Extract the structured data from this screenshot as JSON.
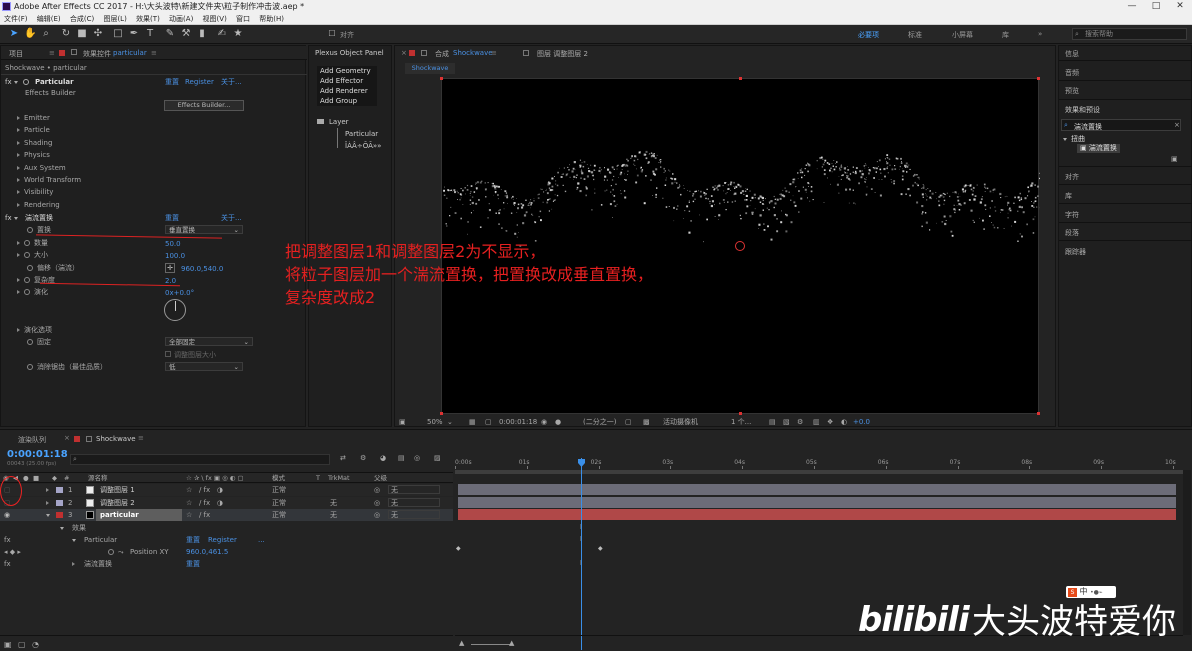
{
  "title": "Adobe After Effects CC 2017 - H:\\大头波特\\新建文件夹\\粒子制作冲击波.aep *",
  "menu": [
    "文件(F)",
    "编辑(E)",
    "合成(C)",
    "图层(L)",
    "效果(T)",
    "动画(A)",
    "视图(V)",
    "窗口",
    "帮助(H)"
  ],
  "toolbar": {
    "snap_label": "对齐",
    "workspaces": [
      "必要项",
      "标准",
      "小屏幕",
      "库"
    ],
    "search_placeholder": "搜索帮助",
    "overflow": "»"
  },
  "effects_panel": {
    "tab_project": "项目",
    "tab_effects": "效果控件",
    "layer_name": "particular",
    "breadcrumb": "Shockwave • particular",
    "effect1": {
      "name": "Particular",
      "reset": "重置",
      "register": "Register",
      "about": "关于...",
      "builder_label": "Effects Builder",
      "builder_button": "Effects Builder..."
    },
    "groups": [
      "Emitter",
      "Particle",
      "Shading",
      "Physics",
      "Aux System",
      "World Transform",
      "Visibility",
      "Rendering"
    ],
    "effect2": {
      "name": "湍流置换",
      "reset": "重置",
      "about": "关于..."
    },
    "props": [
      {
        "label": "置换",
        "value": "垂直置换"
      },
      {
        "label": "数量",
        "value": "50.0"
      },
      {
        "label": "大小",
        "value": "100.0"
      },
      {
        "label": "偏移（湍流）",
        "value": "960.0,540.0"
      },
      {
        "label": "复杂度",
        "value": "2.0"
      },
      {
        "label": "演化",
        "value": "0x+0.0°"
      }
    ],
    "evo_options": "演化选项",
    "pin": {
      "label": "固定",
      "value": "全部固定"
    },
    "resize_layer": "调整图层大小",
    "antialias": {
      "label": "消除锯齿（最佳品质）",
      "value": "低"
    }
  },
  "plexus": {
    "title": "Plexus Object Panel",
    "items": [
      "Add Geometry",
      "Add Effector",
      "Add Renderer",
      "Add Group"
    ],
    "tree_root": "Layer",
    "tree_children": [
      "Particular",
      "ÎÀÂ÷ÕÃ»»"
    ]
  },
  "comp_panel": {
    "tab1_prefix": "合成",
    "tab1_name": "Shockwave",
    "tab2": "图层 调整图层 2",
    "flow_tab": "Shockwave",
    "zoom": "50%",
    "time": "0:00:01:18",
    "resolution": "(二分之一)",
    "camera": "活动摄像机",
    "views": "1 个...",
    "exposure": "+0.0"
  },
  "annotation": [
    "把调整图层1和调整图层2为不显示，",
    "将粒子图层加一个湍流置换，把置换改成垂直置换，",
    "复杂度改成2"
  ],
  "right_panel": {
    "items_top": [
      "信息",
      "音频",
      "预览"
    ],
    "effects_presets": "效果和预设",
    "search_value": "湍流置换",
    "category": "扭曲",
    "result": "湍流置换",
    "items_bottom": [
      "对齐",
      "库",
      "字符",
      "段落",
      "跟踪器"
    ]
  },
  "timeline": {
    "tab_render": "渲染队列",
    "tab_comp": "Shockwave",
    "timecode": "0:00:01:18",
    "fps": "00043 (25.00 fps)",
    "headers": {
      "name": "源名称",
      "mode": "模式",
      "t": "T",
      "trkmat": "TrkMat",
      "parent": "父级"
    },
    "layers": [
      {
        "num": "1",
        "name": "调整图层 1",
        "mode": "正常",
        "trk": "",
        "parent": "无"
      },
      {
        "num": "2",
        "name": "调整图层 2",
        "mode": "正常",
        "trk": "无",
        "parent": "无"
      },
      {
        "num": "3",
        "name": "particular",
        "mode": "正常",
        "trk": "无",
        "parent": "无"
      }
    ],
    "effects_label": "效果",
    "particular_label": "Particular",
    "particular_reset": "重置",
    "particular_register": "Register",
    "particular_dots": "...",
    "posxy_label": "Position XY",
    "posxy_value": "960.0,461.5",
    "turb_label": "湍流置换",
    "turb_reset": "重置",
    "ruler": [
      "0:00s",
      "01s",
      "02s",
      "03s",
      "04s",
      "05s",
      "06s",
      "07s",
      "08s",
      "09s",
      "10s"
    ]
  },
  "watermark": {
    "brand": "bilibili",
    "text": "大头波特爱你"
  },
  "ime": "中"
}
